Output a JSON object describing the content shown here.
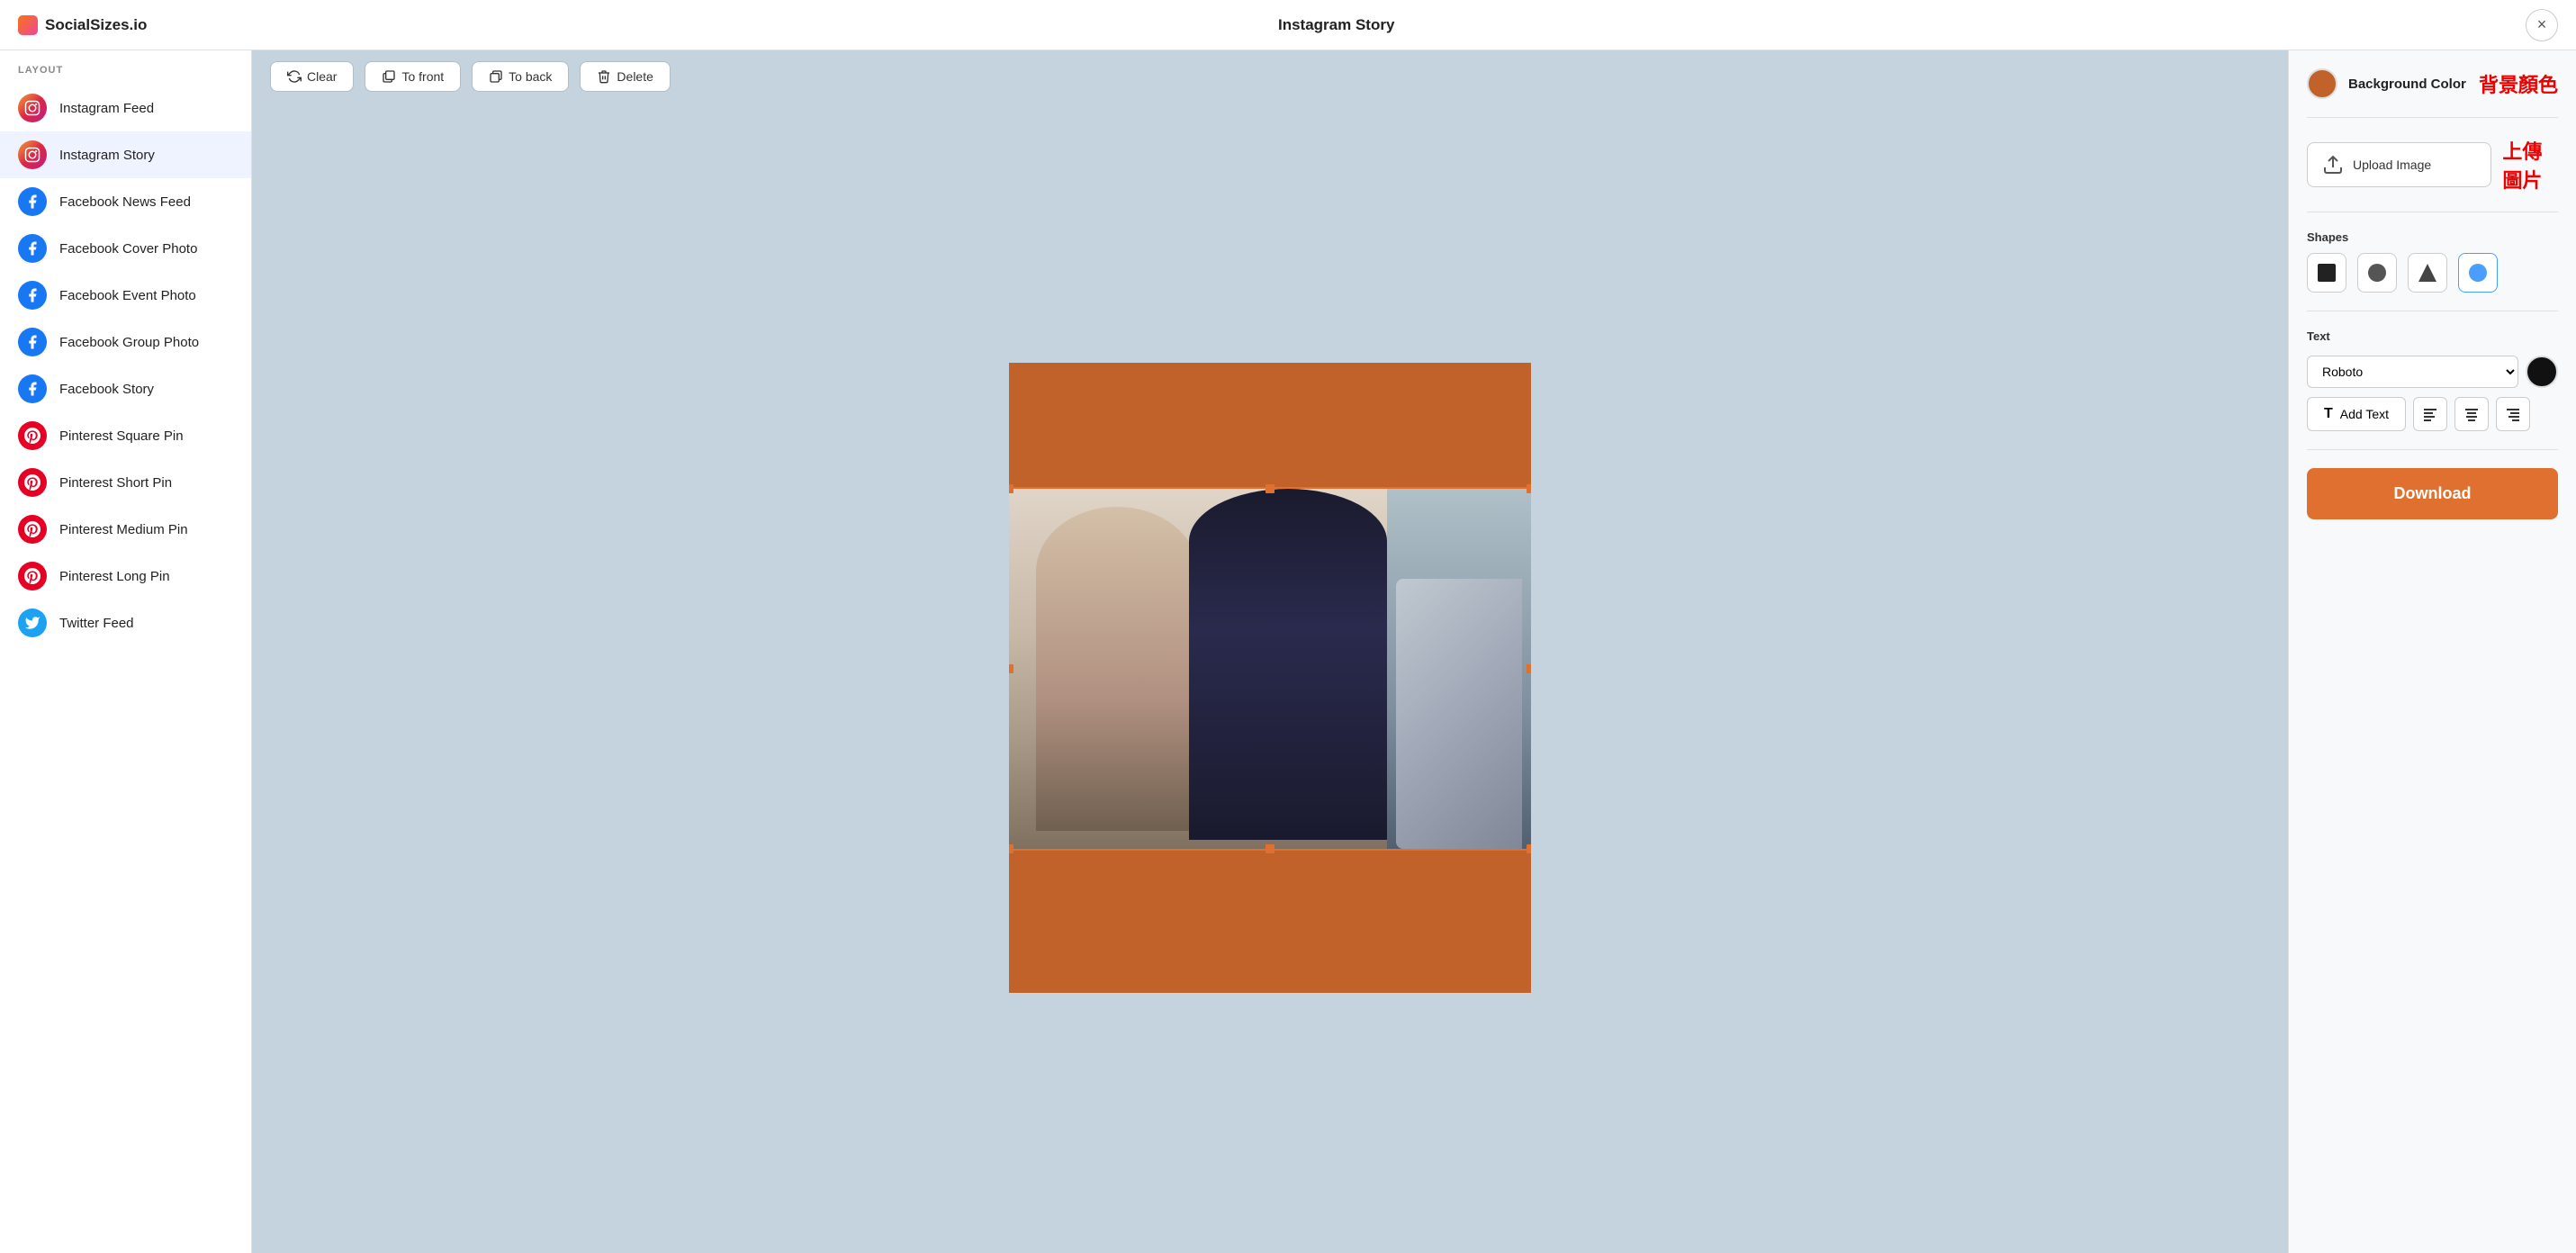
{
  "header": {
    "logo_text": "SocialSizes.io",
    "title": "Instagram Story",
    "close_label": "×"
  },
  "sidebar": {
    "section_label": "LAYOUT",
    "items": [
      {
        "id": "instagram-feed",
        "label": "Instagram Feed",
        "icon_type": "instagram"
      },
      {
        "id": "instagram-story",
        "label": "Instagram Story",
        "icon_type": "instagram",
        "active": true
      },
      {
        "id": "facebook-news-feed",
        "label": "Facebook News Feed",
        "icon_type": "facebook"
      },
      {
        "id": "facebook-cover-photo",
        "label": "Facebook Cover Photo",
        "icon_type": "facebook"
      },
      {
        "id": "facebook-event-photo",
        "label": "Facebook Event Photo",
        "icon_type": "facebook"
      },
      {
        "id": "facebook-group-photo",
        "label": "Facebook Group Photo",
        "icon_type": "facebook"
      },
      {
        "id": "facebook-story",
        "label": "Facebook Story",
        "icon_type": "facebook"
      },
      {
        "id": "pinterest-square-pin",
        "label": "Pinterest Square Pin",
        "icon_type": "pinterest"
      },
      {
        "id": "pinterest-short-pin",
        "label": "Pinterest Short Pin",
        "icon_type": "pinterest"
      },
      {
        "id": "pinterest-medium-pin",
        "label": "Pinterest Medium Pin",
        "icon_type": "pinterest"
      },
      {
        "id": "pinterest-long-pin",
        "label": "Pinterest Long Pin",
        "icon_type": "pinterest"
      },
      {
        "id": "twitter-feed",
        "label": "Twitter Feed",
        "icon_type": "twitter"
      }
    ]
  },
  "toolbar": {
    "clear_label": "Clear",
    "to_front_label": "To front",
    "to_back_label": "To back",
    "delete_label": "Delete"
  },
  "right_panel": {
    "bg_color_label": "Background Color",
    "bg_color_chinese": "背景顏色",
    "upload_label": "Upload Image",
    "upload_chinese": "上傳圖片",
    "shapes_label": "Shapes",
    "text_label": "Text",
    "font_value": "Roboto",
    "add_text_label": "Add Text",
    "download_label": "Download"
  }
}
